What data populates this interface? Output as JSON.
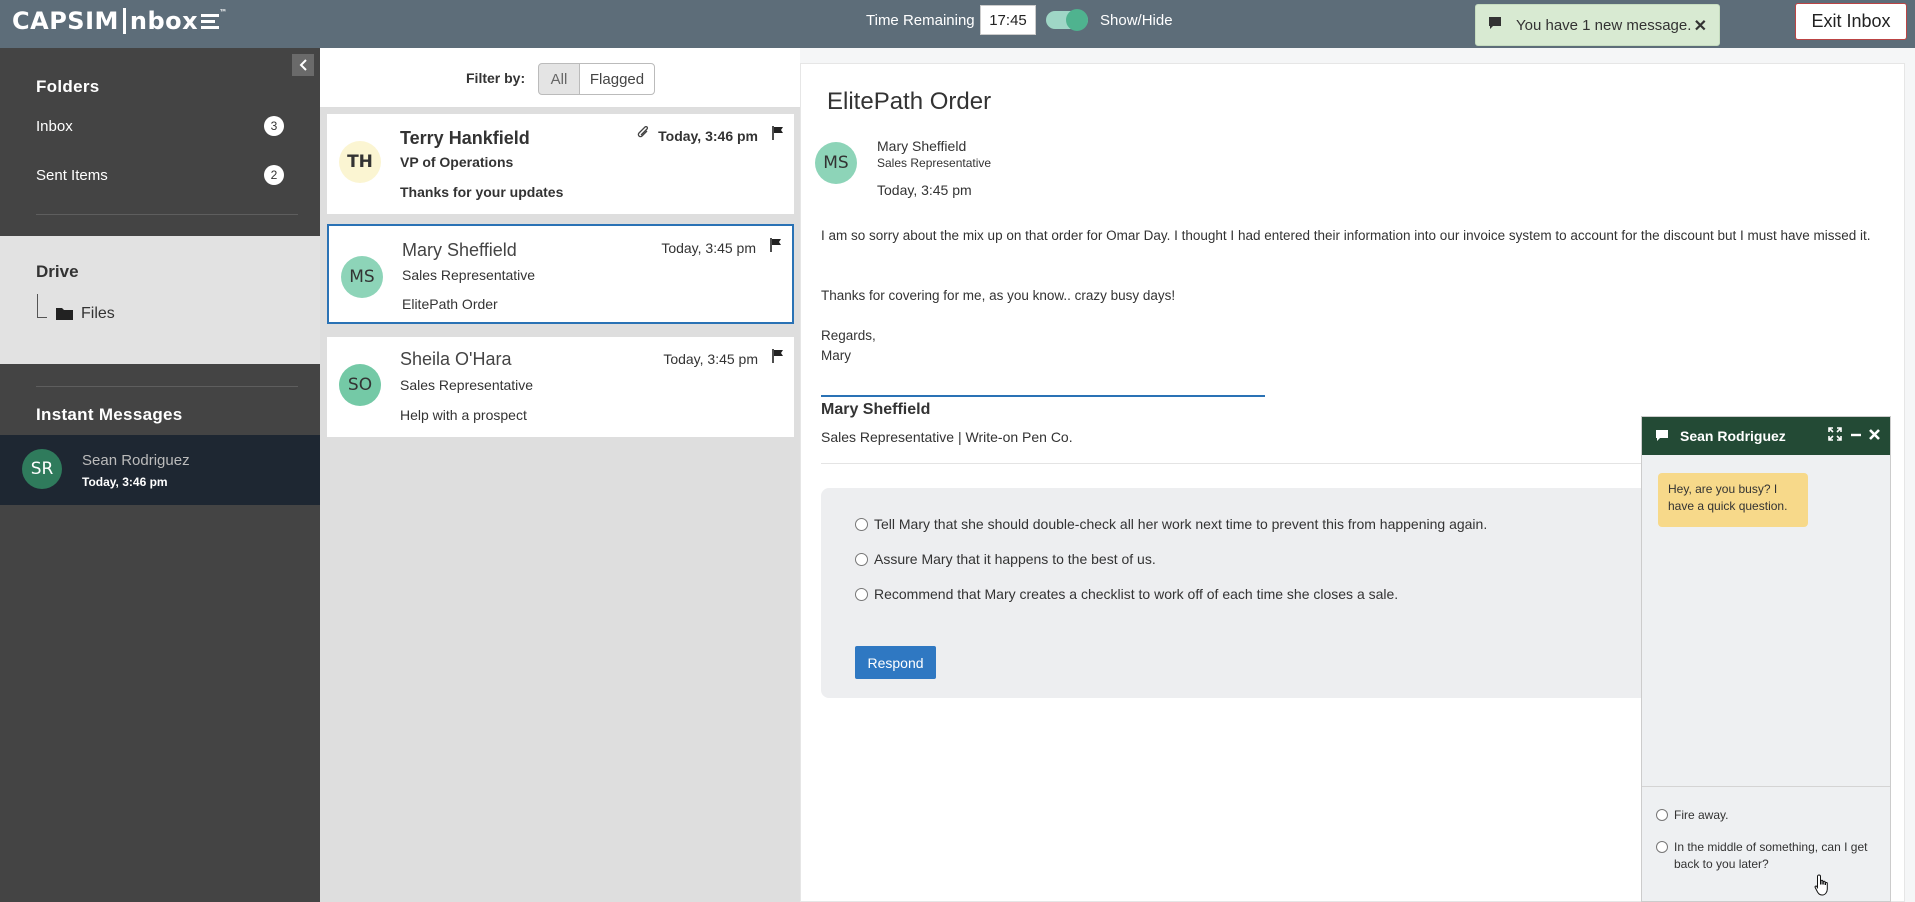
{
  "topbar": {
    "logo_left": "CAPSIM",
    "logo_right": "nbox",
    "logo_tm": "™",
    "time_label": "Time Remaining",
    "time_value": "17:45",
    "toggle_label": "Show/Hide",
    "toast_text": "You have 1 new message.",
    "toast_close": "✕",
    "exit_label": "Exit Inbox"
  },
  "sidebar": {
    "folders_title": "Folders",
    "folders": [
      {
        "label": "Inbox",
        "count": "3"
      },
      {
        "label": "Sent Items",
        "count": "2"
      }
    ],
    "drive_title": "Drive",
    "drive_files": "Files",
    "im_title": "Instant Messages",
    "im_items": [
      {
        "initials": "SR",
        "name": "Sean Rodriguez",
        "time": "Today, 3:46 pm"
      }
    ]
  },
  "message_list": {
    "filter_label": "Filter by:",
    "filter_all": "All",
    "filter_flagged": "Flagged",
    "messages": [
      {
        "initials": "TH",
        "name": "Terry Hankfield",
        "role": "VP of Operations",
        "subject": "Thanks for your updates",
        "time": "Today, 3:46 pm",
        "unread": true,
        "attachment": true,
        "avatar_color": "#fbf5d2"
      },
      {
        "initials": "MS",
        "name": "Mary Sheffield",
        "role": "Sales Representative",
        "subject": "ElitePath Order",
        "time": "Today, 3:45 pm",
        "unread": false,
        "selected": true,
        "avatar_color": "#8dd4b8"
      },
      {
        "initials": "SO",
        "name": "Sheila O'Hara",
        "role": "Sales Representative",
        "subject": "Help with a prospect",
        "time": "Today, 3:45 pm",
        "unread": false,
        "avatar_color": "#74c9a6"
      }
    ]
  },
  "reader": {
    "title": "ElitePath Order",
    "from_initials": "MS",
    "from_name": "Mary Sheffield",
    "from_role": "Sales Representative",
    "from_time": "Today, 3:45 pm",
    "body_1": "I am so sorry about the mix up on that order for Omar Day. I thought I had entered their information into our invoice system to account for the discount but I must have missed it.",
    "body_2": "Thanks for covering for me, as you know.. crazy busy days!",
    "body_3a": "Regards,",
    "body_3b": "Mary",
    "sig_name": "Mary Sheffield",
    "sig_role": "Sales Representative | Write-on Pen Co.",
    "options": [
      "Tell Mary that she should double-check all her work next time to prevent this from happening again.",
      "Assure Mary that it happens to the best of us.",
      "Recommend that Mary creates a checklist to work off of each time she closes a sale."
    ],
    "respond_label": "Respond"
  },
  "chat": {
    "title": "Sean Rodriguez",
    "incoming": "Hey, are you busy? I have a quick question.",
    "options": [
      "Fire away.",
      "In the middle of something, can I get back to you later?"
    ]
  },
  "colors": {
    "topbar": "#5d6d79",
    "sidebar": "#444444",
    "accent": "#2a72b5",
    "chat_header": "#234a35",
    "bubble": "#f7d98a"
  }
}
